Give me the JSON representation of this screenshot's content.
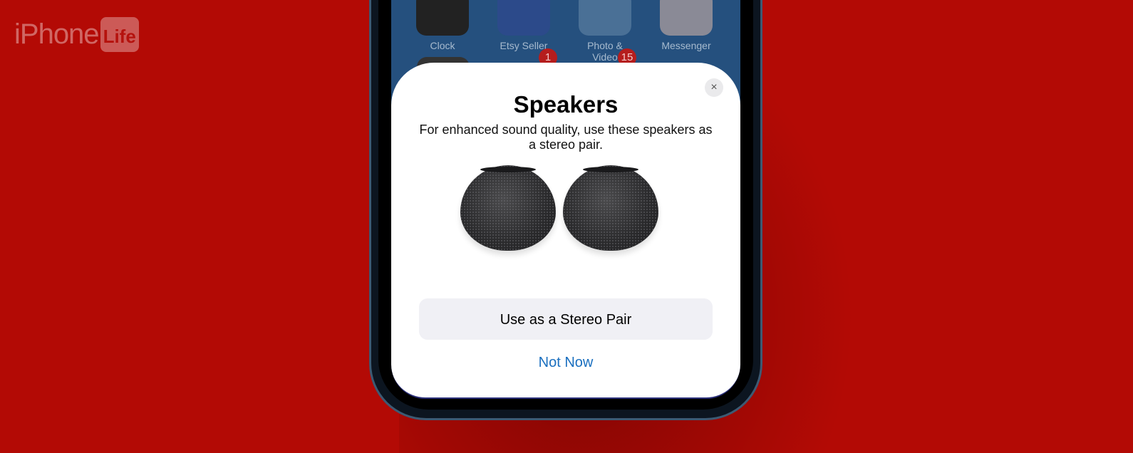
{
  "brand": {
    "logo_main": "iPhone",
    "logo_badge": "Life"
  },
  "home_screen": {
    "apps": [
      {
        "label": "Clock",
        "icon": "clock-icon"
      },
      {
        "label": "Etsy Seller",
        "icon": "etsy-icon"
      },
      {
        "label": "Photo & Video",
        "icon": "folder-icon"
      },
      {
        "label": "Messenger",
        "icon": "messenger-icon"
      }
    ],
    "badges": [
      "1",
      "15"
    ]
  },
  "sheet": {
    "title": "Speakers",
    "description": "For enhanced sound quality, use these speakers as a stereo pair.",
    "close_icon": "×",
    "primary_button": "Use as a Stereo Pair",
    "secondary_button": "Not Now"
  },
  "colors": {
    "background": "#b30a05",
    "link": "#1a6fbf",
    "button_bg": "#f0f0f5"
  }
}
